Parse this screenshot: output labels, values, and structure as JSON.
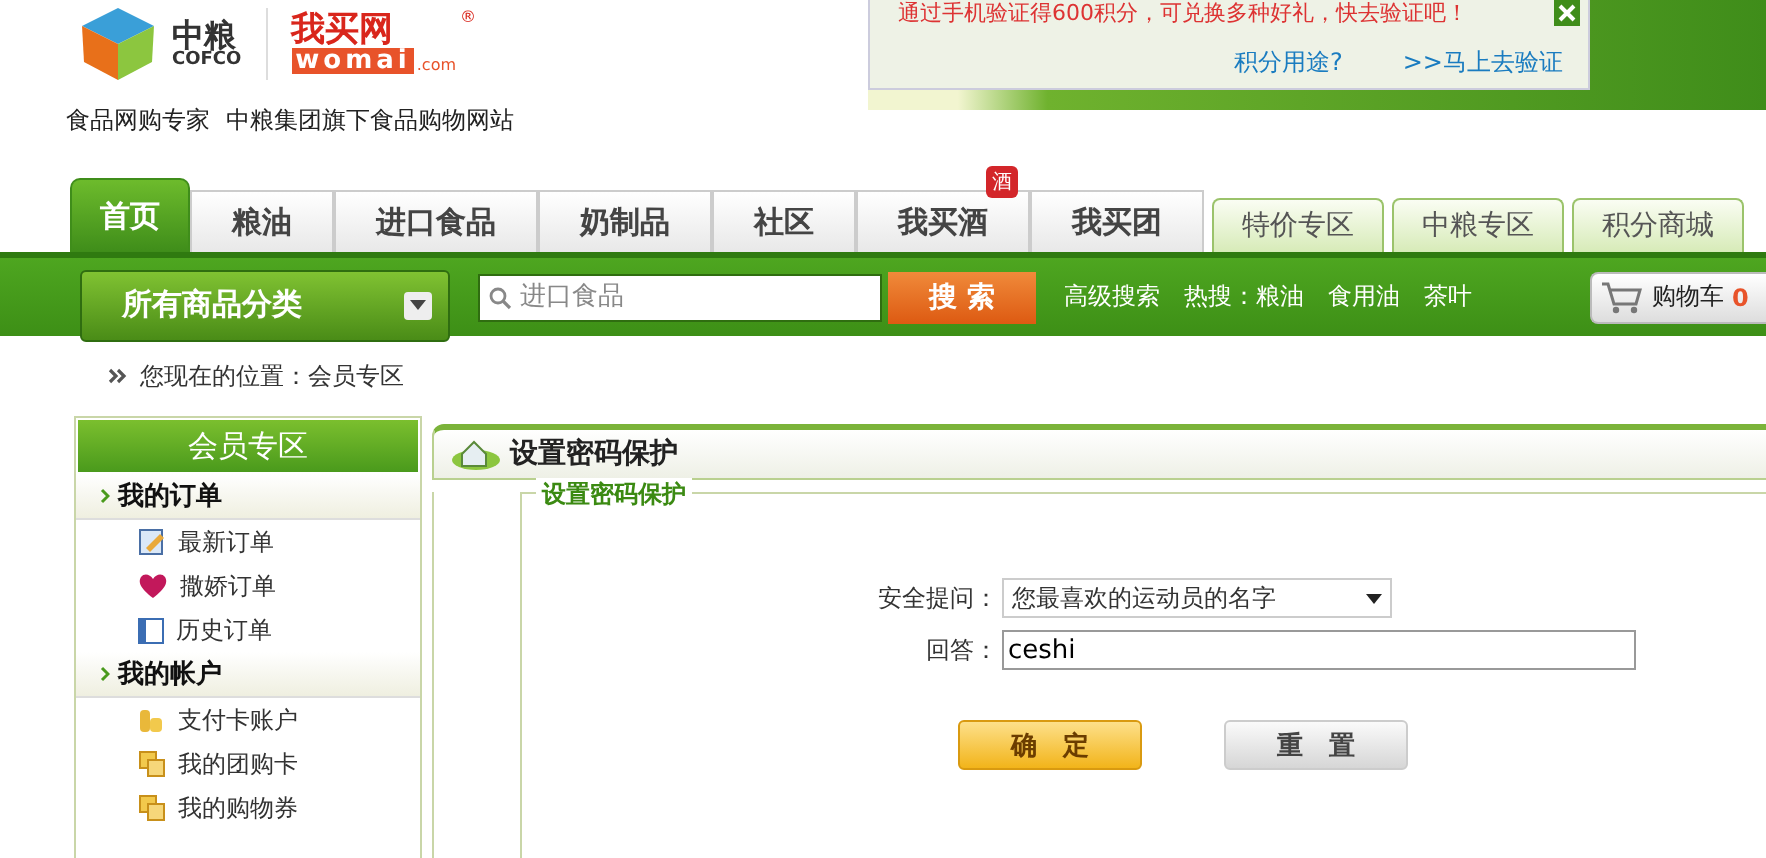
{
  "logo": {
    "brand_cn": "中粮",
    "brand_en": "COFCO",
    "site_cn": "我买网",
    "site_en": "womai",
    "site_domain": ".com",
    "registered": "®"
  },
  "tagline": [
    "食品网购专家",
    "中粮集团旗下食品购物网站"
  ],
  "notice": {
    "message": "通过手机验证得600积分，可兑换多种好礼，快去验证吧！",
    "links": [
      "积分用途?",
      ">>马上去验证"
    ]
  },
  "nav_tabs": [
    {
      "label": "首页",
      "selected": true
    },
    {
      "label": "粮油",
      "selected": false
    },
    {
      "label": "进口食品",
      "selected": false
    },
    {
      "label": "奶制品",
      "selected": false
    },
    {
      "label": "社区",
      "selected": false
    },
    {
      "label": "我买酒",
      "selected": false,
      "badge": "酒"
    },
    {
      "label": "我买团",
      "selected": false
    }
  ],
  "special_tabs": [
    "特价专区",
    "中粮专区",
    "积分商城"
  ],
  "search_bar": {
    "category_button": "所有商品分类",
    "placeholder": "进口食品",
    "search_button": "搜 索",
    "advanced_link": "高级搜索",
    "hot_label": "热搜：",
    "hot_links": [
      "粮油",
      "食用油",
      "茶叶"
    ],
    "cart_label": "购物车",
    "cart_count": "0"
  },
  "breadcrumb": "您现在的位置：会员专区",
  "sidebar": {
    "title": "会员专区",
    "sections": [
      {
        "title": "我的订单",
        "items": [
          {
            "label": "最新订单",
            "kind": "edit"
          },
          {
            "label": "撒娇订单",
            "kind": "heart"
          },
          {
            "label": "历史订单",
            "kind": "window"
          }
        ]
      },
      {
        "title": "我的帐户",
        "items": [
          {
            "label": "支付卡账户",
            "kind": "coins"
          },
          {
            "label": "我的团购卡",
            "kind": "card"
          },
          {
            "label": "我的购物券",
            "kind": "card"
          }
        ]
      }
    ]
  },
  "panel": {
    "title": "设置密码保护",
    "legend": "设置密码保护",
    "question_label": "安全提问：",
    "question_value": "您最喜欢的运动员的名字",
    "answer_label": "回答：",
    "answer_value": "ceshi",
    "buttons": [
      {
        "label": "确　定",
        "kind": "primary"
      },
      {
        "label": "重　置",
        "kind": "secondary"
      }
    ]
  }
}
